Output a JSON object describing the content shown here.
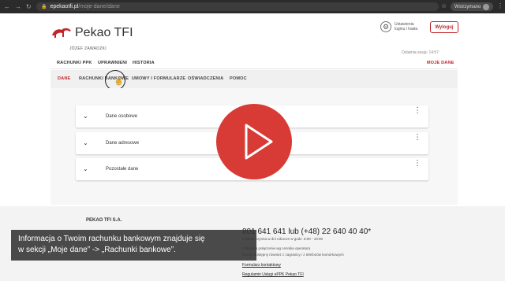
{
  "browser": {
    "host": "epekaotfi.pl",
    "path": "/moje-dane/dane",
    "paused_label": "Wstrzymano",
    "nav_symbols": [
      "←",
      "→",
      "↻"
    ],
    "star_symbol": "☆",
    "menu_symbol": "⋮"
  },
  "header": {
    "brand": "Pekao TFI",
    "username": "JÓZEF ZAWADZKI",
    "settings_line1": "Ustawienia",
    "settings_line2": "loginu i hasła",
    "logout_label": "Wyloguj",
    "last_login": "Ostatnia sesja: 14:57"
  },
  "main_nav": {
    "items": [
      "RACHUNKI PPK",
      "UPRAWNIENI",
      "HISTORIA"
    ],
    "right_item": "MOJE DANE"
  },
  "sub_nav": {
    "items": [
      "DANE",
      "RACHUNKI BANKOWE",
      "UMOWY I FORMULARZE",
      "OŚWIADCZENIA",
      "POMOC"
    ],
    "active_index": 0
  },
  "accordion": [
    {
      "label": "Dane osobowe"
    },
    {
      "label": "Dane adresowe"
    },
    {
      "label": "Pozostałe dane"
    }
  ],
  "footer": {
    "company": "PEKAO TFI S.A.",
    "phone": "801 641 641 lub (+48) 22 640 40 40*",
    "hours": "Infolinia czynna w dni robocze w godz. 8:00 - 19:00",
    "note1": "Opłata za połączenie wg cennika operatora",
    "note2": "Numer dostępny również z zagranicy i z telefonów komórkowych",
    "link_contact": "Formularz kontaktowy",
    "link_terms": "Regulamin Usługi ePPK Pekao TFI"
  },
  "caption": {
    "line1": "Informacja o Twoim rachunku bankowym znajduje się",
    "line2": "w sekcji „Moje dane” -> „Rachunki bankowe”."
  },
  "colors": {
    "brand_red": "#c0272d",
    "play_red": "#d83b35"
  }
}
